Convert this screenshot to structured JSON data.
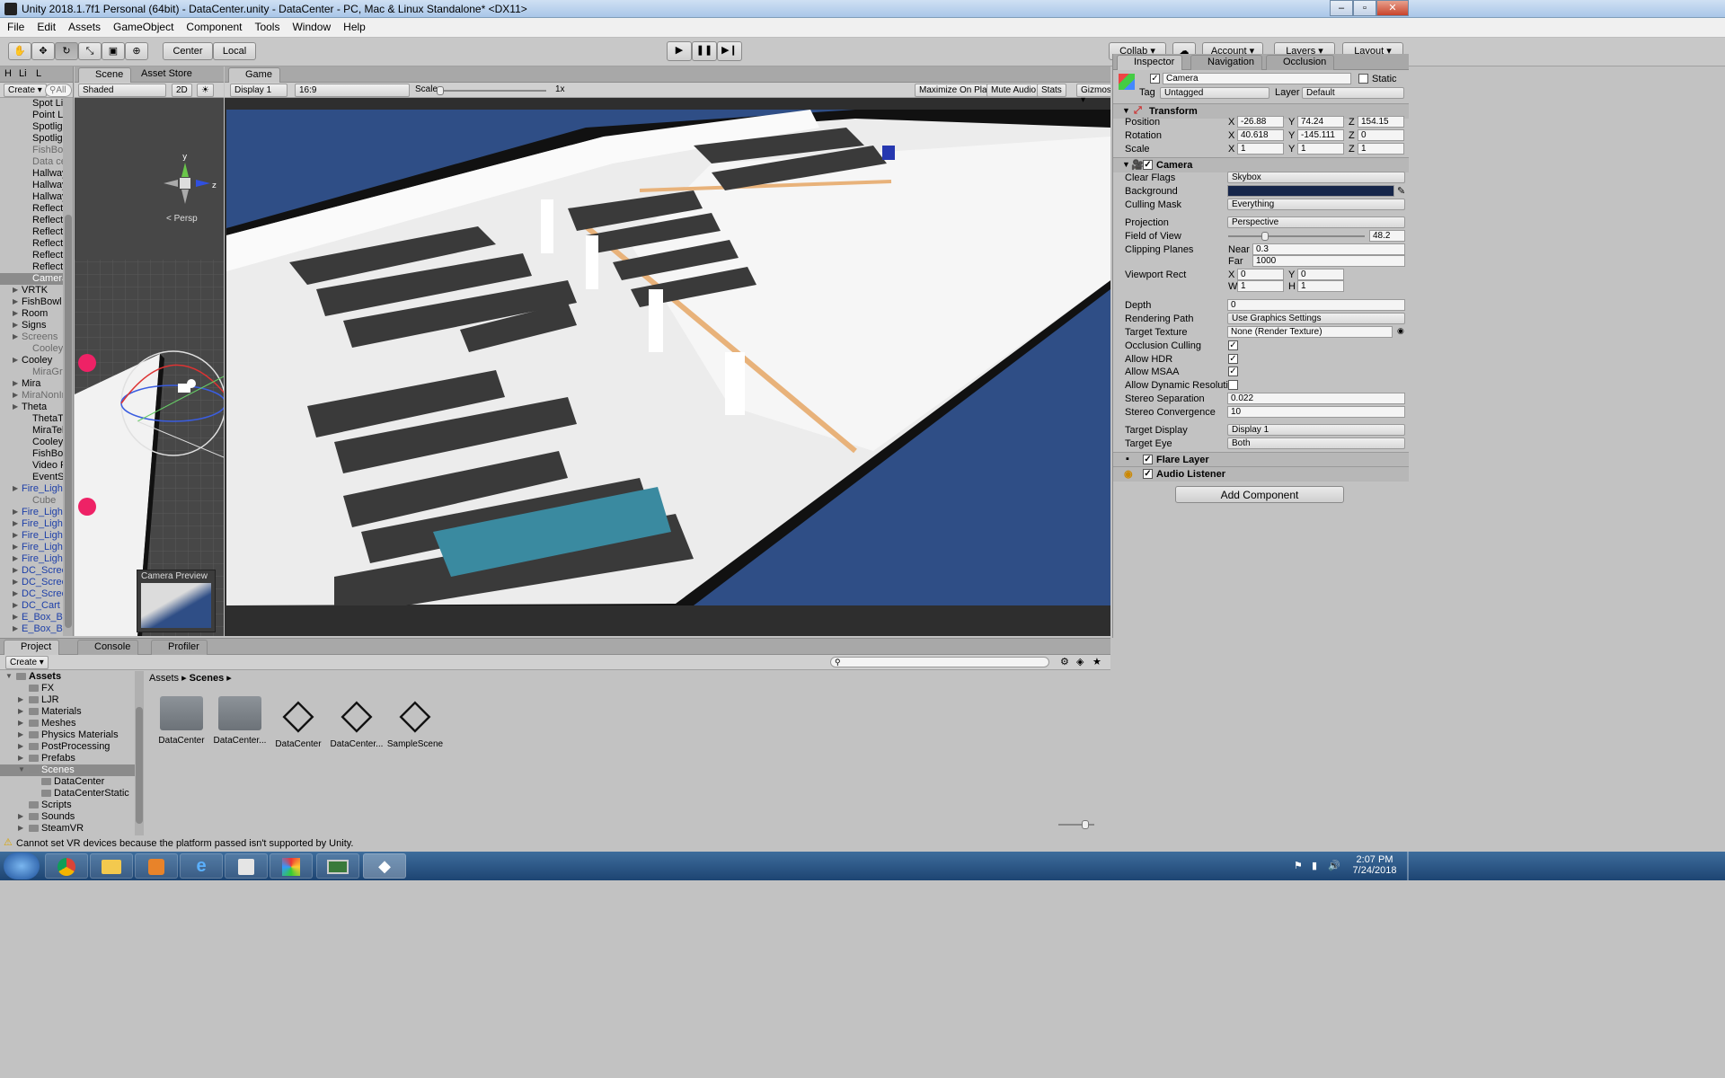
{
  "window": {
    "title": "Unity 2018.1.7f1 Personal (64bit) - DataCenter.unity - DataCenter - PC, Mac & Linux Standalone* <DX11>"
  },
  "menu": [
    "File",
    "Edit",
    "Assets",
    "GameObject",
    "Component",
    "Tools",
    "Window",
    "Help"
  ],
  "toolbar": {
    "pivot": "Center",
    "space": "Local",
    "collab": "Collab",
    "account": "Account",
    "layers": "Layers",
    "layout": "Layout"
  },
  "hierarchy": {
    "tabs": [
      "H",
      "Li",
      "L"
    ],
    "create": "Create",
    "search_placeholder": "All",
    "items": [
      {
        "label": "Spot Li",
        "style": "normal"
      },
      {
        "label": "Point Li",
        "style": "normal"
      },
      {
        "label": "Spotligl",
        "style": "normal"
      },
      {
        "label": "Spotligl",
        "style": "normal"
      },
      {
        "label": "FishBov",
        "style": "gray"
      },
      {
        "label": "Data ce",
        "style": "gray"
      },
      {
        "label": "Hallway",
        "style": "normal"
      },
      {
        "label": "Hallway",
        "style": "normal"
      },
      {
        "label": "Hallway",
        "style": "normal"
      },
      {
        "label": "Reflecti",
        "style": "normal"
      },
      {
        "label": "Reflecti",
        "style": "normal"
      },
      {
        "label": "Reflecti",
        "style": "normal"
      },
      {
        "label": "Reflecti",
        "style": "normal"
      },
      {
        "label": "Reflecti",
        "style": "normal"
      },
      {
        "label": "Reflecti",
        "style": "normal"
      },
      {
        "label": "Camera",
        "style": "sel"
      },
      {
        "label": "VRTK",
        "style": "normal",
        "arrow": true
      },
      {
        "label": "FishBowl",
        "style": "normal",
        "arrow": true
      },
      {
        "label": "Room",
        "style": "normal",
        "arrow": true
      },
      {
        "label": "Signs",
        "style": "normal",
        "arrow": true
      },
      {
        "label": "Screens",
        "style": "gray",
        "arrow": true
      },
      {
        "label": "CooleyGr",
        "style": "gray"
      },
      {
        "label": "Cooley",
        "style": "normal",
        "arrow": true
      },
      {
        "label": "MiraGronl",
        "style": "gray"
      },
      {
        "label": "Mira",
        "style": "normal",
        "arrow": true
      },
      {
        "label": "MiraNonIr",
        "style": "gray",
        "arrow": true
      },
      {
        "label": "Theta",
        "style": "normal",
        "arrow": true
      },
      {
        "label": "ThetaTele",
        "style": "normal"
      },
      {
        "label": "MiraTelep",
        "style": "normal"
      },
      {
        "label": "CooleyTe",
        "style": "normal"
      },
      {
        "label": "FishBowlM",
        "style": "normal"
      },
      {
        "label": "Video Play",
        "style": "normal"
      },
      {
        "label": "EventSyst",
        "style": "normal"
      },
      {
        "label": "Fire_Light",
        "style": "blue",
        "arrow": true
      },
      {
        "label": "Cube",
        "style": "gray"
      },
      {
        "label": "Fire_Light",
        "style": "blue",
        "arrow": true
      },
      {
        "label": "Fire_Light",
        "style": "blue",
        "arrow": true
      },
      {
        "label": "Fire_Light",
        "style": "blue",
        "arrow": true
      },
      {
        "label": "Fire_Light",
        "style": "blue",
        "arrow": true
      },
      {
        "label": "Fire_Light",
        "style": "blue",
        "arrow": true
      },
      {
        "label": "DC_Scree",
        "style": "blue",
        "arrow": true
      },
      {
        "label": "DC_Scree",
        "style": "blue",
        "arrow": true
      },
      {
        "label": "DC_Scree",
        "style": "blue",
        "arrow": true
      },
      {
        "label": "DC_Cart",
        "style": "blue",
        "arrow": true
      },
      {
        "label": "E_Box_Bi",
        "style": "blue",
        "arrow": true
      },
      {
        "label": "E_Box_Bi",
        "style": "blue",
        "arrow": true
      },
      {
        "label": "E_Box_Bi",
        "style": "blue",
        "arrow": true
      },
      {
        "label": "E_Box_Bi",
        "style": "blue",
        "arrow": true
      }
    ]
  },
  "scene": {
    "tab": "Scene",
    "tab2": "Asset Store",
    "shading": "Shaded",
    "mode2d": "2D",
    "persp": "Persp",
    "camera_preview": "Camera Preview"
  },
  "game": {
    "tab": "Game",
    "display": "Display 1",
    "aspect": "16:9",
    "scale_label": "Scale",
    "scale_value": "1x",
    "maximize": "Maximize On Play",
    "mute": "Mute Audio",
    "stats": "Stats",
    "gizmos": "Gizmos"
  },
  "inspector": {
    "tabs": [
      "Inspector",
      "Navigation",
      "Occlusion"
    ],
    "name": "Camera",
    "static": "Static",
    "tag_label": "Tag",
    "tag": "Untagged",
    "layer_label": "Layer",
    "layer": "Default",
    "transform": {
      "title": "Transform",
      "position": {
        "label": "Position",
        "x": "-26.88",
        "y": "74.24",
        "z": "154.15"
      },
      "rotation": {
        "label": "Rotation",
        "x": "40.618",
        "y": "-145.111",
        "z": "0"
      },
      "scale": {
        "label": "Scale",
        "x": "1",
        "y": "1",
        "z": "1"
      }
    },
    "camera": {
      "title": "Camera",
      "clear_flags": {
        "label": "Clear Flags",
        "value": "Skybox"
      },
      "background": {
        "label": "Background",
        "color": "#16264a"
      },
      "culling_mask": {
        "label": "Culling Mask",
        "value": "Everything"
      },
      "projection": {
        "label": "Projection",
        "value": "Perspective"
      },
      "fov": {
        "label": "Field of View",
        "value": "48.2",
        "fraction": 0.27
      },
      "clipping": {
        "label": "Clipping Planes",
        "near_label": "Near",
        "near": "0.3",
        "far_label": "Far",
        "far": "1000"
      },
      "viewport": {
        "label": "Viewport Rect",
        "x": "0",
        "y": "0",
        "w": "1",
        "h": "1"
      },
      "depth": {
        "label": "Depth",
        "value": "0"
      },
      "rendering_path": {
        "label": "Rendering Path",
        "value": "Use Graphics Settings"
      },
      "target_texture": {
        "label": "Target Texture",
        "value": "None (Render Texture)"
      },
      "occlusion_culling": {
        "label": "Occlusion Culling",
        "checked": true
      },
      "allow_hdr": {
        "label": "Allow HDR",
        "checked": true
      },
      "allow_msaa": {
        "label": "Allow MSAA",
        "checked": true
      },
      "allow_dynres": {
        "label": "Allow Dynamic Resolutio",
        "checked": false
      },
      "stereo_sep": {
        "label": "Stereo Separation",
        "value": "0.022"
      },
      "stereo_conv": {
        "label": "Stereo Convergence",
        "value": "10"
      },
      "target_display": {
        "label": "Target Display",
        "value": "Display 1"
      },
      "target_eye": {
        "label": "Target Eye",
        "value": "Both"
      }
    },
    "flare": "Flare Layer",
    "audio": "Audio Listener",
    "add_component": "Add Component"
  },
  "project": {
    "tabs": [
      "Project",
      "Console",
      "Profiler"
    ],
    "create": "Create",
    "tree": [
      {
        "label": "Assets",
        "level": 0,
        "bold": true,
        "arrow": "down"
      },
      {
        "label": "FX",
        "level": 1
      },
      {
        "label": "LJR",
        "level": 1,
        "arrow": "right"
      },
      {
        "label": "Materials",
        "level": 1,
        "arrow": "right"
      },
      {
        "label": "Meshes",
        "level": 1,
        "arrow": "right"
      },
      {
        "label": "Physics Materials",
        "level": 1,
        "arrow": "right"
      },
      {
        "label": "PostProcessing",
        "level": 1,
        "arrow": "right"
      },
      {
        "label": "Prefabs",
        "level": 1,
        "arrow": "right"
      },
      {
        "label": "Scenes",
        "level": 1,
        "arrow": "down",
        "sel": true
      },
      {
        "label": "DataCenter",
        "level": 2
      },
      {
        "label": "DataCenterStatic",
        "level": 2
      },
      {
        "label": "Scripts",
        "level": 1
      },
      {
        "label": "Sounds",
        "level": 1,
        "arrow": "right"
      },
      {
        "label": "SteamVR",
        "level": 1,
        "arrow": "right"
      }
    ],
    "breadcrumb": [
      "Assets",
      "Scenes"
    ],
    "assets": [
      {
        "label": "DataCenter",
        "kind": "folder"
      },
      {
        "label": "DataCenter...",
        "kind": "folder"
      },
      {
        "label": "DataCenter",
        "kind": "unity"
      },
      {
        "label": "DataCenter...",
        "kind": "unity"
      },
      {
        "label": "SampleScene",
        "kind": "unity"
      }
    ]
  },
  "status": "Cannot set VR devices because the platform passed isn't supported by Unity.",
  "taskbar": {
    "time": "2:07 PM",
    "date": "7/24/2018",
    "apps": [
      "windows-start-icon",
      "chrome-icon",
      "explorer-folder-icon",
      "media-player-icon",
      "internet-explorer-icon",
      "slides-icon",
      "paint-icon",
      "remote-desktop-icon",
      "unity-icon"
    ]
  }
}
